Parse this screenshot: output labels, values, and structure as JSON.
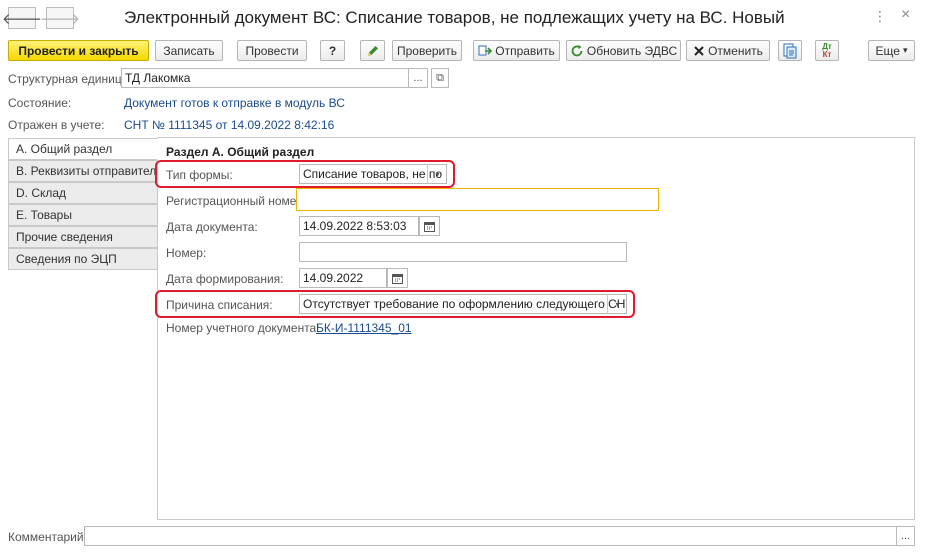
{
  "window": {
    "title": "Электронный документ ВС: Списание товаров, не подлежащих учету на ВС. Новый",
    "menu_icon": "⋮",
    "close_icon": "×"
  },
  "nav": {
    "back": "🡐",
    "forward": "🡒"
  },
  "toolbar": {
    "post_and_close": "Провести и закрыть",
    "save": "Записать",
    "post": "Провести",
    "help": "?",
    "check": "Проверить",
    "send": "Отправить",
    "update_edvs": "Обновить ЭДВС",
    "cancel": "Отменить",
    "dt_kt_top": "Дт",
    "dt_kt_bottom": "Кт",
    "more": "Еще",
    "more_arrow": "▾"
  },
  "header": {
    "unit_label": "Структурная единица:",
    "unit_value": "ТД Лакомка",
    "ellipsis": "...",
    "open_icon": "⧉",
    "state_label": "Состояние:",
    "state_value": "Документ готов к отправке в модуль ВС",
    "reflected_label": "Отражен в учете:",
    "reflected_value": "СНТ № 1111345 от 14.09.2022 8:42:16"
  },
  "tabs": [
    {
      "label": "А. Общий раздел",
      "active": true
    },
    {
      "label": "В. Реквизиты отправителя",
      "active": false
    },
    {
      "label": "D. Склад",
      "active": false
    },
    {
      "label": "Е. Товары",
      "active": false
    },
    {
      "label": "Прочие сведения",
      "active": false
    },
    {
      "label": "Сведения по ЭЦП",
      "active": false
    }
  ],
  "section": {
    "title": "Раздел А. Общий раздел",
    "form_type_label": "Тип формы:",
    "form_type_value": "Списание товаров, не по",
    "reg_number_label": "Регистрационный номер:",
    "reg_number_value": "",
    "doc_date_label": "Дата документа:",
    "doc_date_value": "14.09.2022  8:53:03",
    "number_label": "Номер:",
    "number_value": "",
    "formation_date_label": "Дата формирования:",
    "formation_date_value": "14.09.2022",
    "reason_label": "Причина списания:",
    "reason_value": "Отсутствует требование по оформлению следующего СНТ",
    "accounting_doc_label": "Номер учетного документа:",
    "accounting_doc_value": "БК-И-1111345_01",
    "dropdown_arrow": "▾"
  },
  "comment": {
    "label": "Комментарий:",
    "value": "",
    "ellipsis": "..."
  },
  "colors": {
    "accent_yellow": "#f5d800",
    "highlight_red": "#e01b2c",
    "link_blue": "#1a4b8f",
    "focus_orange": "#f0b400"
  }
}
